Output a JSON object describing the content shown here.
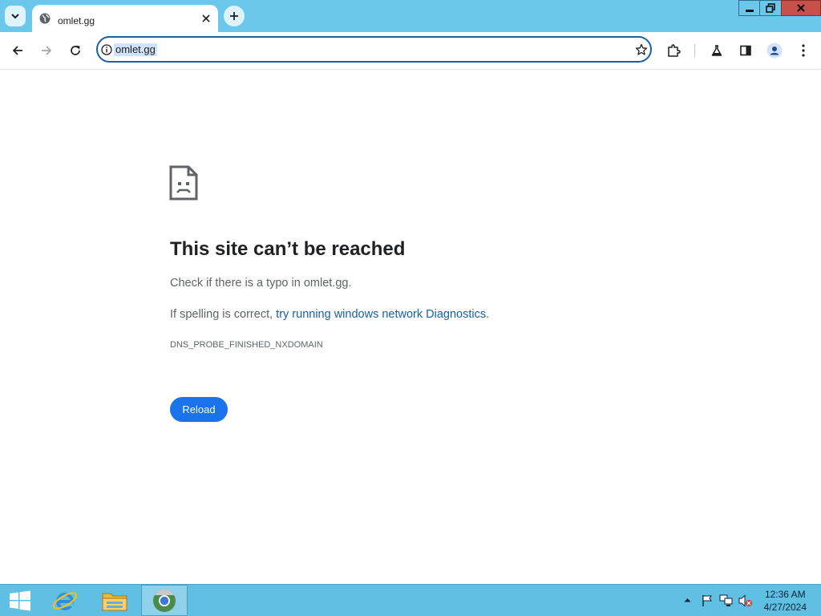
{
  "browser": {
    "tab": {
      "title": "omlet.gg"
    },
    "address_bar": {
      "url": "omlet.gg"
    }
  },
  "error_page": {
    "title": "This site can’t be reached",
    "line1": "Check if there is a typo in omlet.gg.",
    "line2_prefix": "If spelling is correct, ",
    "line2_link": "try running windows network Diagnostics",
    "line2_suffix": ".",
    "error_code": "DNS_PROBE_FINISHED_NXDOMAIN",
    "reload_label": "Reload"
  },
  "taskbar": {
    "time": "12:36 AM",
    "date": "4/27/2024"
  },
  "colors": {
    "tabstrip": "#6cc8ea",
    "accent": "#1a73e8",
    "link": "#1a5fa8",
    "taskbar": "#5fc0e4",
    "close_button": "#c7504a"
  },
  "icons": [
    "chevron-down-icon",
    "globe-icon",
    "close-icon",
    "plus-icon",
    "minimize-icon",
    "restore-icon",
    "back-icon",
    "forward-icon",
    "reload-icon",
    "info-icon",
    "star-icon",
    "extensions-icon",
    "labs-icon",
    "side-panel-icon",
    "profile-icon",
    "menu-icon",
    "sad-page-icon",
    "windows-start-icon",
    "internet-explorer-icon",
    "file-explorer-icon",
    "chrome-icon",
    "tray-arrow-icon",
    "flag-icon",
    "network-icon",
    "volume-muted-icon"
  ]
}
